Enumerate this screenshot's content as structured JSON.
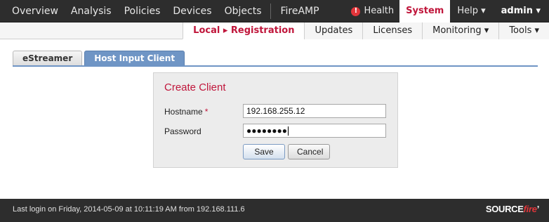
{
  "topnav": {
    "items": [
      "Overview",
      "Analysis",
      "Policies",
      "Devices",
      "Objects"
    ],
    "fireamp": "FireAMP",
    "health": "Health",
    "health_icon": "alert-icon",
    "system": "System",
    "help": "Help ▾",
    "admin": "admin ▾"
  },
  "subnav": {
    "items": [
      {
        "label": "Local ▸ Registration",
        "active": true
      },
      {
        "label": "Updates"
      },
      {
        "label": "Licenses"
      },
      {
        "label": "Monitoring ▾"
      },
      {
        "label": "Tools ▾"
      }
    ]
  },
  "tabs": [
    {
      "label": "eStreamer"
    },
    {
      "label": "Host Input Client",
      "active": true
    }
  ],
  "form": {
    "title": "Create Client",
    "hostname_label": "Hostname",
    "required_mark": "*",
    "hostname_value": "192.168.255.12",
    "password_label": "Password",
    "password_value": "●●●●●●●●",
    "save": "Save",
    "cancel": "Cancel"
  },
  "footer": {
    "last_login": "Last login on Friday, 2014-05-09 at 10:11:19 AM from 192.168.111.6",
    "logo_main": "SOURCE",
    "logo_accent": "fire",
    "logo_mark": "’"
  },
  "colors": {
    "accent": "#c0163b",
    "tab_active": "#6f95c5",
    "bar_dark": "#2d2d2d"
  }
}
